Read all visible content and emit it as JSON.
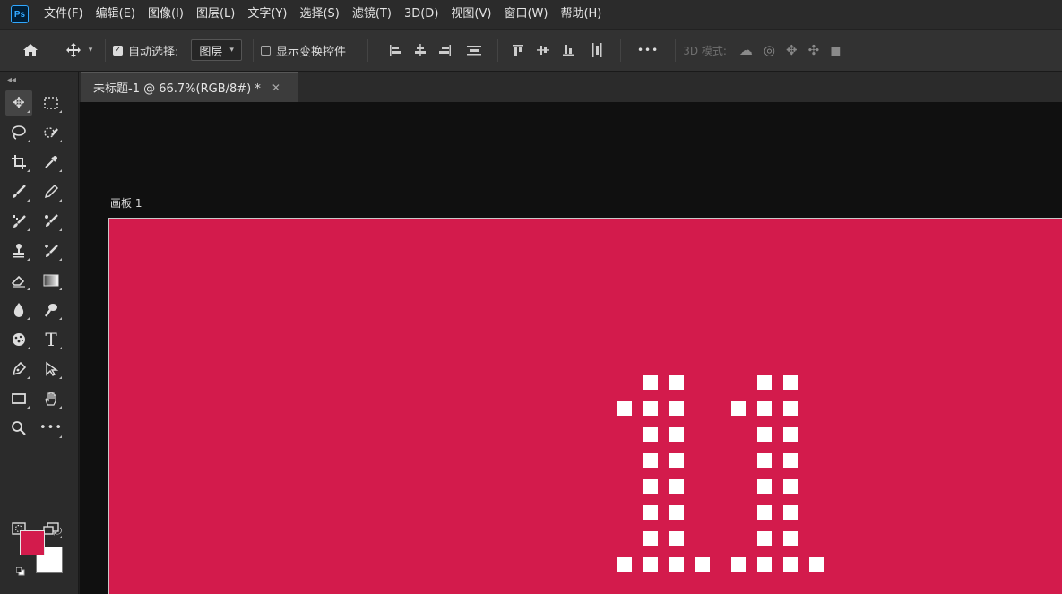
{
  "app": {
    "logo_text": "Ps"
  },
  "menu": [
    "文件(F)",
    "编辑(E)",
    "图像(I)",
    "图层(L)",
    "文字(Y)",
    "选择(S)",
    "滤镜(T)",
    "3D(D)",
    "视图(V)",
    "窗口(W)",
    "帮助(H)"
  ],
  "options": {
    "auto_select_label": "自动选择:",
    "auto_select_checked": true,
    "auto_select_target": "图层",
    "show_transform_label": "显示变换控件",
    "show_transform_checked": false,
    "more_label": "•••",
    "mode_3d_label": "3D 模式:"
  },
  "document": {
    "tab_title": "未标题-1 @ 66.7%(RGB/8#) *",
    "artboard_label": "画板 1",
    "artboard_color": "#d31b4c",
    "glyph_color": "#ffffff"
  },
  "colors": {
    "foreground": "#d31b4c",
    "background": "#ffffff"
  },
  "icons": {
    "home": "home-icon",
    "move": "move-icon",
    "close": "close-icon",
    "swap": "swap-colors-icon"
  }
}
